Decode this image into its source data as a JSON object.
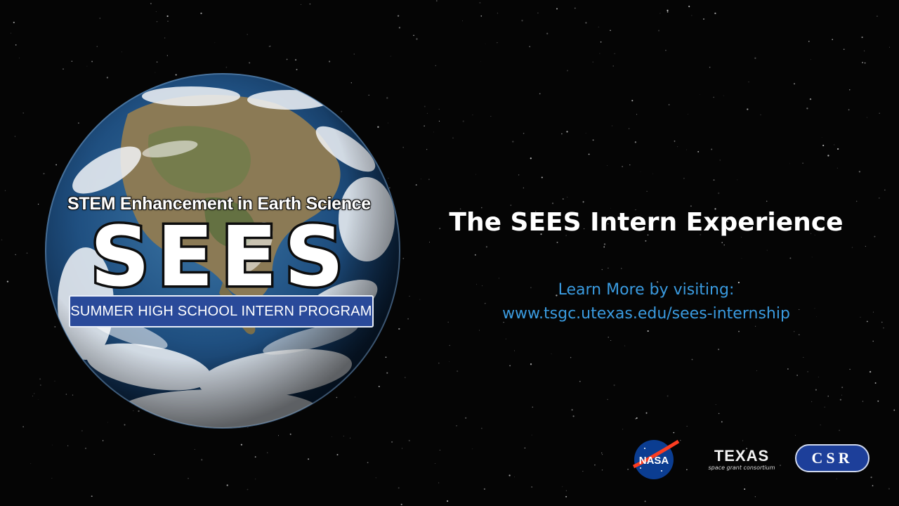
{
  "logo": {
    "tagline": "STEM Enhancement in Earth Science",
    "acronym": "SEES",
    "program": "SUMMER HIGH SCHOOL INTERN PROGRAM"
  },
  "headline": "The SEES Intern Experience",
  "learn_more": {
    "line1": "Learn More by visiting:",
    "url": "www.tsgc.utexas.edu/sees-internship"
  },
  "partners": {
    "nasa": "NASA",
    "texas": "TEXAS",
    "texas_sub": "space grant consortium",
    "csr": "CSR"
  },
  "colors": {
    "background": "#050505",
    "link": "#3a9be0",
    "banner": "#2a4a9a"
  }
}
